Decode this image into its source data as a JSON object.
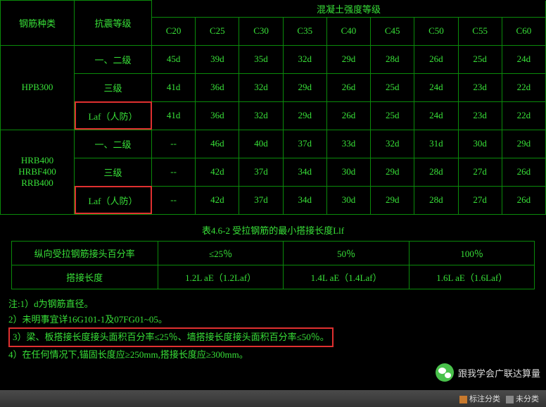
{
  "table1": {
    "head_row1_label": "混凝土强度等级",
    "head_col_steel": "钢筋种类",
    "head_col_seismic": "抗震等级",
    "grades": [
      "C20",
      "C25",
      "C30",
      "C35",
      "C40",
      "C45",
      "C50",
      "C55",
      "C60"
    ],
    "group1_label": "HPB300",
    "group2_label_a": "HRB400",
    "group2_label_b": "HRBF400",
    "group2_label_c": "RRB400",
    "row_labels": {
      "lvl12": "一、二级",
      "lvl3": "三级",
      "laf": "Laf（人防）"
    },
    "group1": {
      "lvl12": [
        "45d",
        "39d",
        "35d",
        "32d",
        "29d",
        "28d",
        "26d",
        "25d",
        "24d"
      ],
      "lvl3": [
        "41d",
        "36d",
        "32d",
        "29d",
        "26d",
        "25d",
        "24d",
        "23d",
        "22d"
      ],
      "laf": [
        "41d",
        "36d",
        "32d",
        "29d",
        "26d",
        "25d",
        "24d",
        "23d",
        "22d"
      ]
    },
    "group2": {
      "lvl12": [
        "--",
        "46d",
        "40d",
        "37d",
        "33d",
        "32d",
        "31d",
        "30d",
        "29d"
      ],
      "lvl3": [
        "--",
        "42d",
        "37d",
        "34d",
        "30d",
        "29d",
        "28d",
        "27d",
        "26d"
      ],
      "laf": [
        "--",
        "42d",
        "37d",
        "34d",
        "30d",
        "29d",
        "28d",
        "27d",
        "26d"
      ]
    }
  },
  "table2": {
    "title": "表4.6-2   受拉钢筋的最小搭接长度Llf",
    "row1_label": "纵向受拉钢筋接头百分率",
    "row1": [
      "≤25％",
      "50％",
      "100％"
    ],
    "row2_label": "搭接长度",
    "row2": [
      "1.2L aE（1.2Laf）",
      "1.4L aE（1.4Laf）",
      "1.6L aE（1.6Laf）"
    ]
  },
  "notes": {
    "n1": "注:1）d为钢筋直径。",
    "n2": "2）未明事宜详16G101-1及07FG01~05。",
    "n3": "3）梁、板搭接长度接头面积百分率≤25％、墙搭接长度接头面积百分率≤50％。",
    "n4": "4）在任何情况下,锚固长度应≥250mm,搭接长度应≥300mm。"
  },
  "footer": {
    "wechat_label": "跟我学会广联达算量",
    "tag1": "标注分类",
    "tag2": "未分类"
  }
}
